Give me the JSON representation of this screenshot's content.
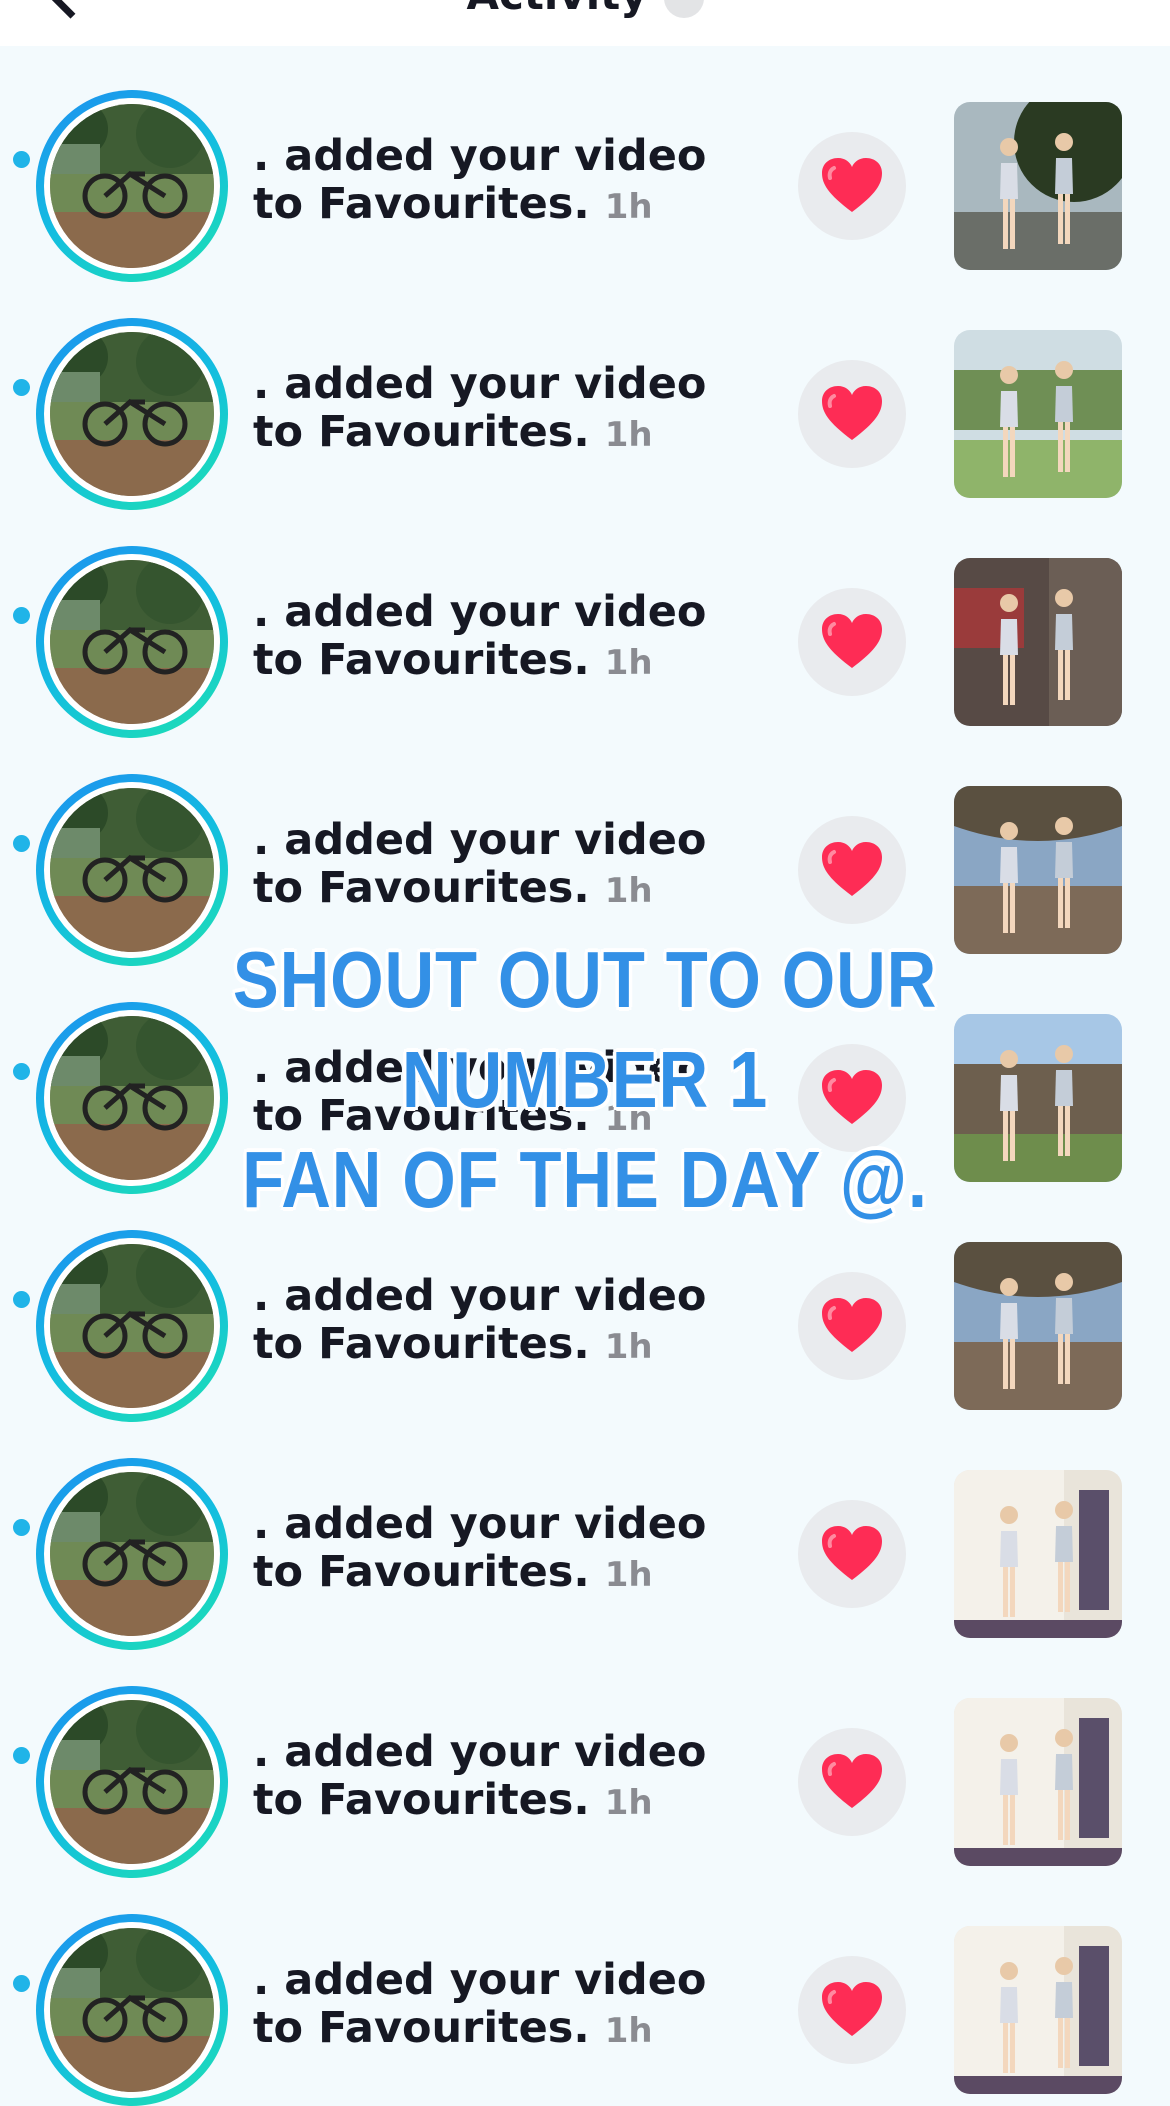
{
  "header": {
    "title": "Activity"
  },
  "caption": {
    "line1": "SHOUT OUT TO OUR NUMBER 1",
    "line2": "FAN OF THE DAY @."
  },
  "notifications": [
    {
      "text": ". added your video to Favourites.",
      "time": "1h",
      "thumb_scene": "outdoor-dusk"
    },
    {
      "text": ". added your video to Favourites.",
      "time": "1h",
      "thumb_scene": "park"
    },
    {
      "text": ". added your video to Favourites.",
      "time": "1h",
      "thumb_scene": "train"
    },
    {
      "text": ". added your video to Favourites.",
      "time": "1h",
      "thumb_scene": "patio"
    },
    {
      "text": ". added your video to Favourites.",
      "time": "1h",
      "thumb_scene": "backyard"
    },
    {
      "text": ". added your video to Favourites.",
      "time": "1h",
      "thumb_scene": "patio"
    },
    {
      "text": ". added your video to Favourites.",
      "time": "1h",
      "thumb_scene": "bedroom"
    },
    {
      "text": ". added your video to Favourites.",
      "time": "1h",
      "thumb_scene": "bedroom"
    },
    {
      "text": ". added your video to Favourites.",
      "time": "1h",
      "thumb_scene": "bedroom"
    }
  ],
  "icons": {
    "heart": "heart-icon",
    "back": "chevron-left-icon"
  },
  "colors": {
    "heart": "#fe2c55",
    "ring_start": "#1e8ef0",
    "ring_end": "#1ee2b0",
    "unread_dot": "#20b4e8",
    "caption": "#3390e6"
  }
}
